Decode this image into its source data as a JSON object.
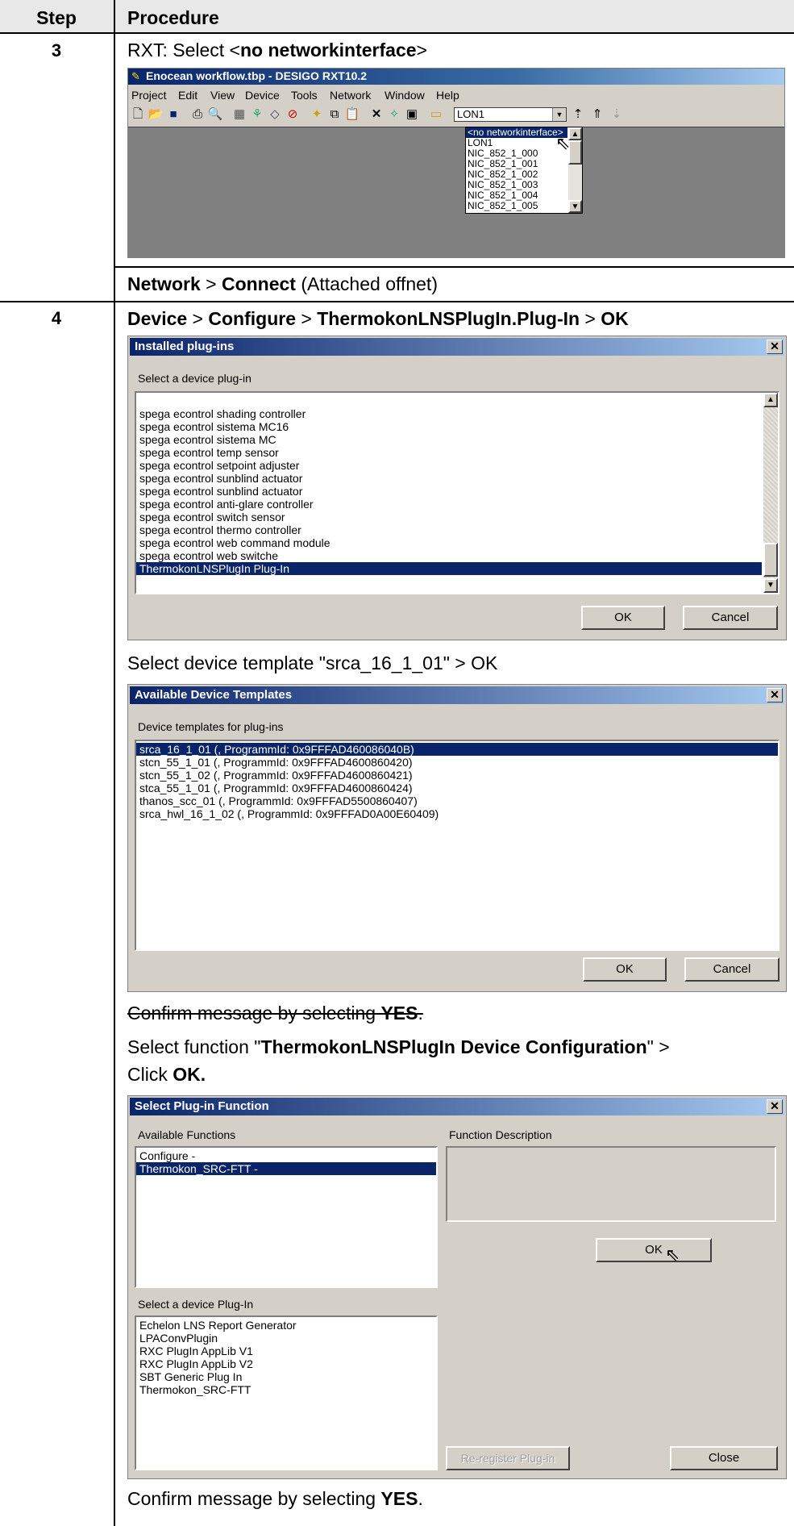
{
  "table": {
    "header_step": "Step",
    "header_procedure": "Procedure"
  },
  "step3": {
    "number": "3",
    "instruction_prefix": "RXT: Select <",
    "instruction_bold": "no networkinterface",
    "instruction_suffix": ">",
    "screenshot": {
      "title": "Enocean workflow.tbp - DESIGO RXT10.2",
      "menu": [
        "Project",
        "Edit",
        "View",
        "Device",
        "Tools",
        "Network",
        "Window",
        "Help"
      ],
      "combo_value": "LON1",
      "dropdown_items": [
        "<no networkinterface>",
        "LON1",
        "NIC_852_1_000",
        "NIC_852_1_001",
        "NIC_852_1_002",
        "NIC_852_1_003",
        "NIC_852_1_004",
        "NIC_852_1_005"
      ],
      "dropdown_selected_index": 0
    },
    "connect": {
      "part1": "Network",
      "sep": " > ",
      "part2": "Connect",
      "part3": " (Attached offnet)"
    }
  },
  "step4": {
    "number": "4",
    "heading": {
      "a": "Device",
      "b": "Configure",
      "c": "ThermokonLNSPlugIn.Plug-In",
      "d": "OK",
      "sep": " > "
    },
    "installed_plugins": {
      "title": "Installed plug-ins",
      "prompt": "Select a device plug-in",
      "items": [
        "spega econtrol shading controller",
        "spega econtrol sistema MC16",
        "spega econtrol sistema MC",
        "spega econtrol temp sensor",
        "spega econtrol setpoint adjuster",
        "spega econtrol sunblind actuator",
        "spega econtrol sunblind actuator",
        "spega econtrol anti-glare controller",
        "spega econtrol switch sensor",
        "spega econtrol thermo controller",
        "spega econtrol web command module",
        "spega econtrol web switche",
        "ThermokonLNSPlugIn Plug-In"
      ],
      "selected_index": 12,
      "ok": "OK",
      "cancel": "Cancel"
    },
    "select_template_text": "Select device template \"srca_16_1_01\" > OK",
    "device_templates": {
      "title": "Available Device Templates",
      "prompt": "Device templates for plug-ins",
      "items": [
        "srca_16_1_01   (, ProgrammId: 0x9FFFAD460086040B)",
        "stcn_55_1_01   (, ProgrammId: 0x9FFFAD4600860420)",
        "stcn_55_1_02   (, ProgrammId: 0x9FFFAD4600860421)",
        "stca_55_1_01   (, ProgrammId: 0x9FFFAD4600860424)",
        "thanos_scc_01   (, ProgrammId: 0x9FFFAD5500860407)",
        "srca_hwl_16_1_02   (, ProgrammId: 0x9FFFAD0A00E60409)"
      ],
      "selected_index": 0,
      "ok": "OK",
      "cancel": "Cancel"
    },
    "confirm_struck": {
      "text": "Confirm message by selecting ",
      "bold": "YES",
      "end": "."
    },
    "select_function": {
      "a": "Select function \"",
      "b": "ThermokonLNSPlugIn Device Configuration",
      "c": "\" >",
      "d": "Click ",
      "e": "OK."
    },
    "plugin_function": {
      "title": "Select Plug-in Function",
      "available_label": "Available Functions",
      "functions": [
        "Configure -",
        "Thermokon_SRC-FTT -"
      ],
      "functions_selected_index": 1,
      "description_label": "Function Description",
      "ok": "OK",
      "device_label": "Select a device Plug-In",
      "plugins": [
        "Echelon LNS Report Generator",
        "LPAConvPlugin",
        "RXC PlugIn AppLib V1",
        "RXC PlugIn AppLib V2",
        "SBT Generic Plug In",
        "Thermokon_SRC-FTT"
      ],
      "reregister": "Re-register Plug-in",
      "close": "Close"
    },
    "confirm_final": {
      "text": "Confirm message by selecting ",
      "bold": "YES",
      "end": "."
    }
  }
}
